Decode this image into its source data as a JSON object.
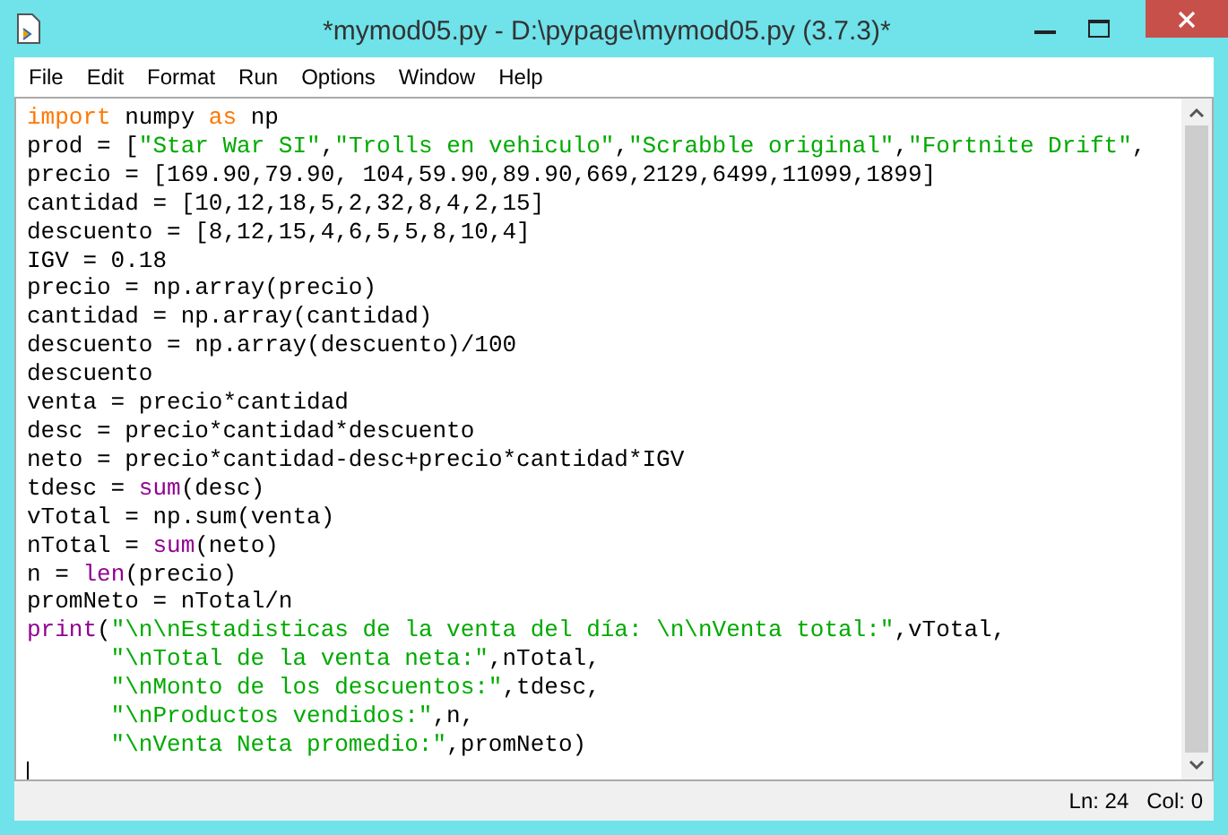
{
  "window": {
    "title": "*mymod05.py - D:\\pypage\\mymod05.py (3.7.3)*"
  },
  "menu": [
    "File",
    "Edit",
    "Format",
    "Run",
    "Options",
    "Window",
    "Help"
  ],
  "code": [
    {
      "indented": false,
      "tokens": [
        {
          "kind": "keyword",
          "text": "import"
        },
        {
          "kind": "plain",
          "text": " numpy "
        },
        {
          "kind": "keyword",
          "text": "as"
        },
        {
          "kind": "plain",
          "text": " np"
        }
      ]
    },
    {
      "indented": false,
      "tokens": [
        {
          "kind": "plain",
          "text": "prod = ["
        },
        {
          "kind": "string",
          "text": "\"Star War SI\""
        },
        {
          "kind": "plain",
          "text": ","
        },
        {
          "kind": "string",
          "text": "\"Trolls en vehiculo\""
        },
        {
          "kind": "plain",
          "text": ","
        },
        {
          "kind": "string",
          "text": "\"Scrabble original\""
        },
        {
          "kind": "plain",
          "text": ","
        },
        {
          "kind": "string",
          "text": "\"Fortnite Drift\""
        },
        {
          "kind": "plain",
          "text": ","
        }
      ]
    },
    {
      "indented": false,
      "tokens": [
        {
          "kind": "plain",
          "text": "precio = [169.90,79.90, 104,59.90,89.90,669,2129,6499,11099,1899]"
        }
      ]
    },
    {
      "indented": false,
      "tokens": [
        {
          "kind": "plain",
          "text": "cantidad = [10,12,18,5,2,32,8,4,2,15]"
        }
      ]
    },
    {
      "indented": false,
      "tokens": [
        {
          "kind": "plain",
          "text": "descuento = [8,12,15,4,6,5,5,8,10,4]"
        }
      ]
    },
    {
      "indented": false,
      "tokens": [
        {
          "kind": "plain",
          "text": "IGV = 0.18"
        }
      ]
    },
    {
      "indented": false,
      "tokens": [
        {
          "kind": "plain",
          "text": "precio = np.array(precio)"
        }
      ]
    },
    {
      "indented": false,
      "tokens": [
        {
          "kind": "plain",
          "text": "cantidad = np.array(cantidad)"
        }
      ]
    },
    {
      "indented": false,
      "tokens": [
        {
          "kind": "plain",
          "text": "descuento = np.array(descuento)/100"
        }
      ]
    },
    {
      "indented": false,
      "tokens": [
        {
          "kind": "plain",
          "text": "descuento"
        }
      ]
    },
    {
      "indented": false,
      "tokens": [
        {
          "kind": "plain",
          "text": "venta = precio*cantidad"
        }
      ]
    },
    {
      "indented": false,
      "tokens": [
        {
          "kind": "plain",
          "text": "desc = precio*cantidad*descuento"
        }
      ]
    },
    {
      "indented": false,
      "tokens": [
        {
          "kind": "plain",
          "text": "neto = precio*cantidad-desc+precio*cantidad*IGV"
        }
      ]
    },
    {
      "indented": false,
      "tokens": [
        {
          "kind": "plain",
          "text": "tdesc = "
        },
        {
          "kind": "builtin",
          "text": "sum"
        },
        {
          "kind": "plain",
          "text": "(desc)"
        }
      ]
    },
    {
      "indented": false,
      "tokens": [
        {
          "kind": "plain",
          "text": "vTotal = np.sum(venta)"
        }
      ]
    },
    {
      "indented": false,
      "tokens": [
        {
          "kind": "plain",
          "text": "nTotal = "
        },
        {
          "kind": "builtin",
          "text": "sum"
        },
        {
          "kind": "plain",
          "text": "(neto)"
        }
      ]
    },
    {
      "indented": false,
      "tokens": [
        {
          "kind": "plain",
          "text": "n = "
        },
        {
          "kind": "builtin",
          "text": "len"
        },
        {
          "kind": "plain",
          "text": "(precio)"
        }
      ]
    },
    {
      "indented": false,
      "tokens": [
        {
          "kind": "plain",
          "text": "promNeto = nTotal/n"
        }
      ]
    },
    {
      "indented": false,
      "tokens": [
        {
          "kind": "builtin",
          "text": "print"
        },
        {
          "kind": "plain",
          "text": "("
        },
        {
          "kind": "string",
          "text": "\"\\n\\nEstadisticas de la venta del día: \\n\\nVenta total:\""
        },
        {
          "kind": "plain",
          "text": ",vTotal,"
        }
      ]
    },
    {
      "indented": true,
      "tokens": [
        {
          "kind": "string",
          "text": "\"\\nTotal de la venta neta:\""
        },
        {
          "kind": "plain",
          "text": ",nTotal,"
        }
      ]
    },
    {
      "indented": true,
      "tokens": [
        {
          "kind": "string",
          "text": "\"\\nMonto de los descuentos:\""
        },
        {
          "kind": "plain",
          "text": ",tdesc,"
        }
      ]
    },
    {
      "indented": true,
      "tokens": [
        {
          "kind": "string",
          "text": "\"\\nProductos vendidos:\""
        },
        {
          "kind": "plain",
          "text": ",n,"
        }
      ]
    },
    {
      "indented": true,
      "tokens": [
        {
          "kind": "string",
          "text": "\"\\nVenta Neta promedio:\""
        },
        {
          "kind": "plain",
          "text": ",promNeto)"
        }
      ]
    }
  ],
  "status_bar": {
    "line": "Ln: 24",
    "col": "Col: 0"
  }
}
